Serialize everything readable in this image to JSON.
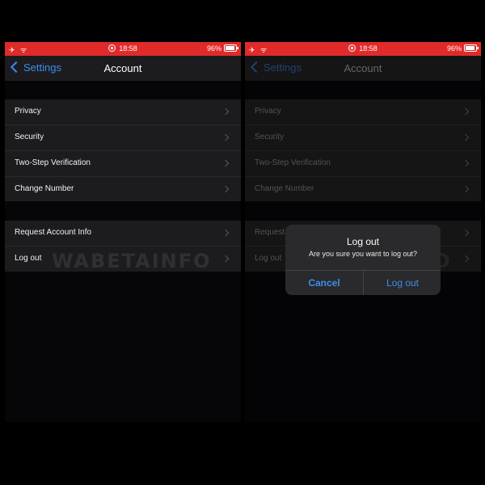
{
  "status_bar": {
    "left_icons": "✈ ᯤ",
    "time": "18:58",
    "battery": "96%"
  },
  "nav": {
    "back_label": "Settings",
    "title": "Account"
  },
  "group1": [
    "Privacy",
    "Security",
    "Two-Step Verification",
    "Change Number"
  ],
  "group2": [
    "Request Account Info",
    "Log out"
  ],
  "watermark": "WABETAINFO",
  "alert": {
    "title": "Log out",
    "message": "Are you sure you want to log out?",
    "cancel": "Cancel",
    "confirm": "Log out"
  },
  "colors": {
    "status_bar": "#e02b2a",
    "accent": "#3a8ef0",
    "background": "#060608",
    "cell": "#1c1c1e"
  }
}
